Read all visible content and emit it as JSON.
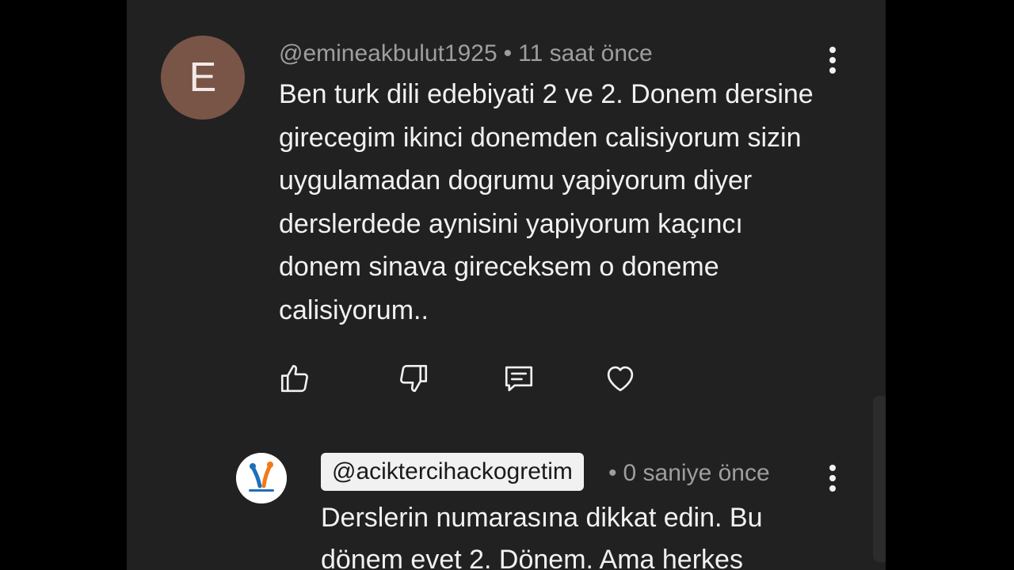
{
  "comment": {
    "avatar_letter": "E",
    "avatar_color": "#795548",
    "author": "@emineakbulut1925",
    "separator": "•",
    "time": "11 saat önce",
    "text": "Ben turk dili edebiyati 2 ve 2. Donem dersine girecegim ikinci donemden calisiyorum sizin uygulamadan dogrumu yapiyorum diyer derslerdede aynisini yapiyorum kaçıncı  donem sinava gireceksem o doneme calisiyorum..",
    "actions": {
      "like_icon": "thumbs-up-icon",
      "dislike_icon": "thumbs-down-icon",
      "reply_icon": "reply-comment-icon",
      "heart_icon": "heart-icon"
    }
  },
  "reply": {
    "avatar_icon": "channel-logo",
    "author": "@aciktercihackogretim",
    "separator": "•",
    "time": "0 saniye önce",
    "text": "Derslerin numarasına dikkat edin. Bu dönem evet 2. Dönem. Ama herkes"
  },
  "colors": {
    "background": "#212121",
    "text_primary": "#f1f1f1",
    "text_secondary": "#9e9e9e",
    "chip_bg": "#f1f1f1"
  }
}
